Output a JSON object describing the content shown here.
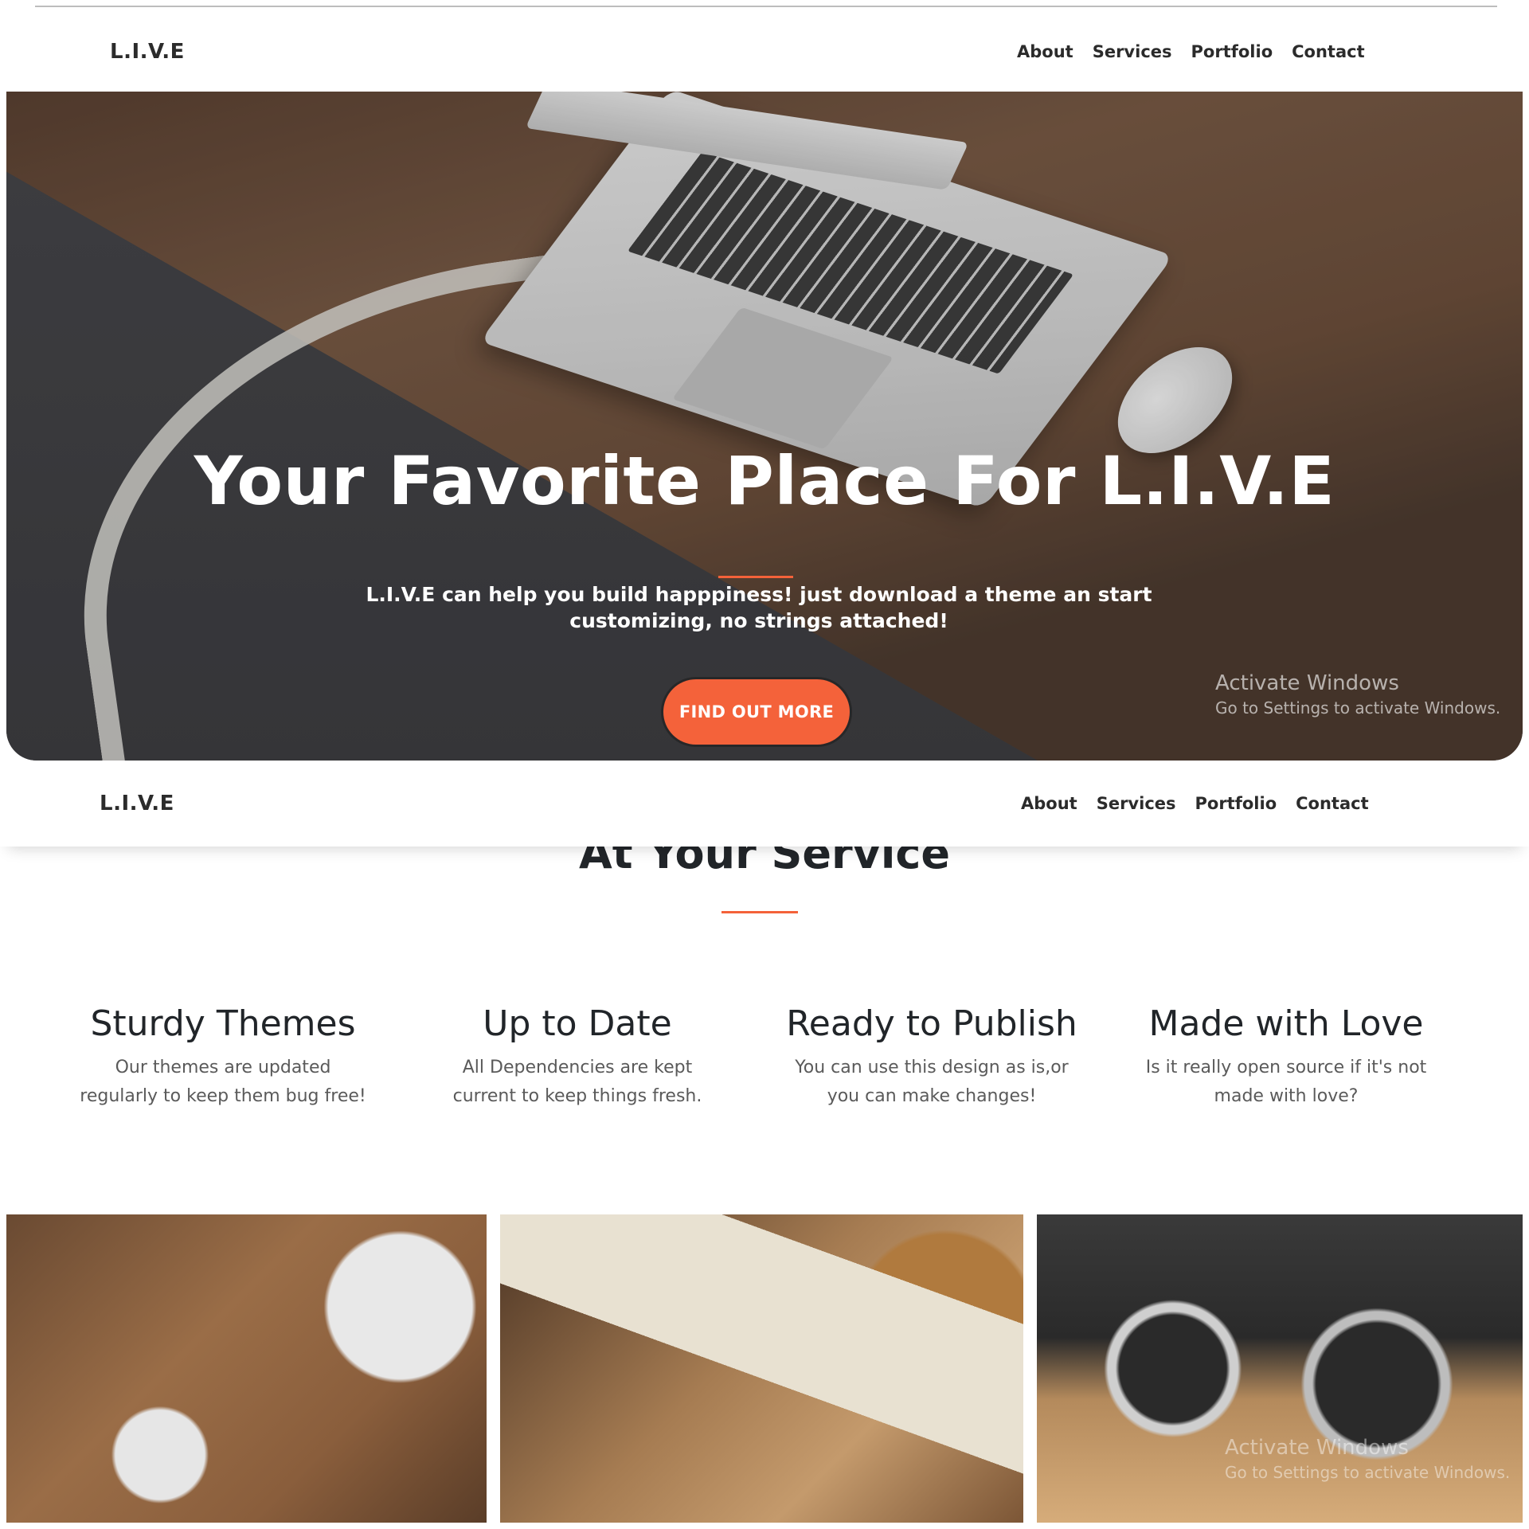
{
  "navbar": {
    "brand": "L.I.V.E",
    "links": [
      "About",
      "Services",
      "Portfolio",
      "Contact"
    ]
  },
  "hero": {
    "title": "Your Favorite Place For L.I.V.E",
    "lead": "L.I.V.E can help you build happpiness! just download a theme an start customizing, no strings attached!",
    "button_label": "FIND OUT MORE"
  },
  "services": {
    "heading": "At Your Service",
    "items": [
      {
        "title": "Sturdy Themes",
        "text": "Our themes are updated regularly to keep them bug free!"
      },
      {
        "title": "Up to Date",
        "text": "All Dependencies are kept current to keep things fresh."
      },
      {
        "title": "Ready to Publish",
        "text": "You can use this design as is,or you can make changes!"
      },
      {
        "title": "Made with Love",
        "text": "Is it really open source if it's not made with love?"
      }
    ]
  },
  "watermark": {
    "line1": "Activate Windows",
    "line2": "Go to Settings to activate Windows."
  },
  "colors": {
    "accent": "#f4623a",
    "text": "#212529"
  }
}
